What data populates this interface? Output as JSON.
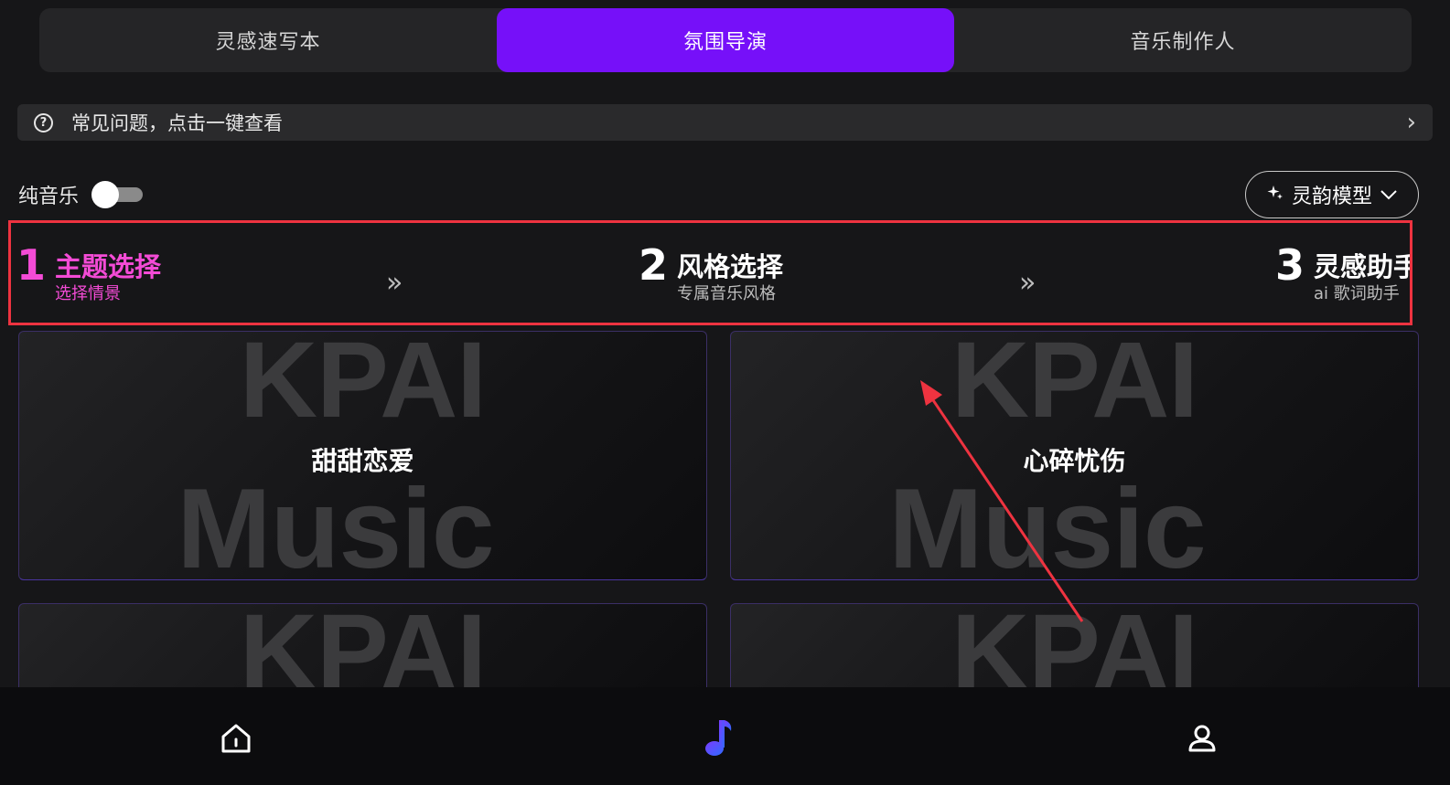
{
  "tabs": [
    {
      "label": "灵感速写本",
      "active": false
    },
    {
      "label": "氛围导演",
      "active": true
    },
    {
      "label": "音乐制作人",
      "active": false
    }
  ],
  "faq": {
    "text": "常见问题，点击一键查看",
    "icon": "question-circle-icon"
  },
  "pure_music": {
    "label": "纯音乐",
    "enabled": false
  },
  "model_selector": {
    "label": "灵韵模型",
    "icon": "sparkle-icon"
  },
  "steps": [
    {
      "number": "1",
      "title": "主题选择",
      "subtitle": "选择情景",
      "active": true
    },
    {
      "number": "2",
      "title": "风格选择",
      "subtitle": "专属音乐风格",
      "active": false
    },
    {
      "number": "3",
      "title": "灵感助手",
      "subtitle": "ai 歌词助手",
      "active": false
    }
  ],
  "cards": [
    {
      "title": "甜甜恋爱",
      "watermark_top": "KPAI",
      "watermark_bottom": "Music"
    },
    {
      "title": "心碎忧伤",
      "watermark_top": "KPAI",
      "watermark_bottom": "Music"
    },
    {
      "title": "",
      "watermark_top": "KPAI",
      "watermark_bottom": ""
    },
    {
      "title": "",
      "watermark_top": "KPAI",
      "watermark_bottom": ""
    }
  ],
  "bottom_nav": [
    {
      "name": "home",
      "icon": "home-icon",
      "active": false
    },
    {
      "name": "music",
      "icon": "music-note-icon",
      "active": true
    },
    {
      "name": "profile",
      "icon": "user-icon",
      "active": false
    }
  ],
  "colors": {
    "accent": "#7610f9",
    "step_active": "#f44bd6",
    "annotation": "#ee3340",
    "nav_active_blue": "#3b5cff"
  }
}
